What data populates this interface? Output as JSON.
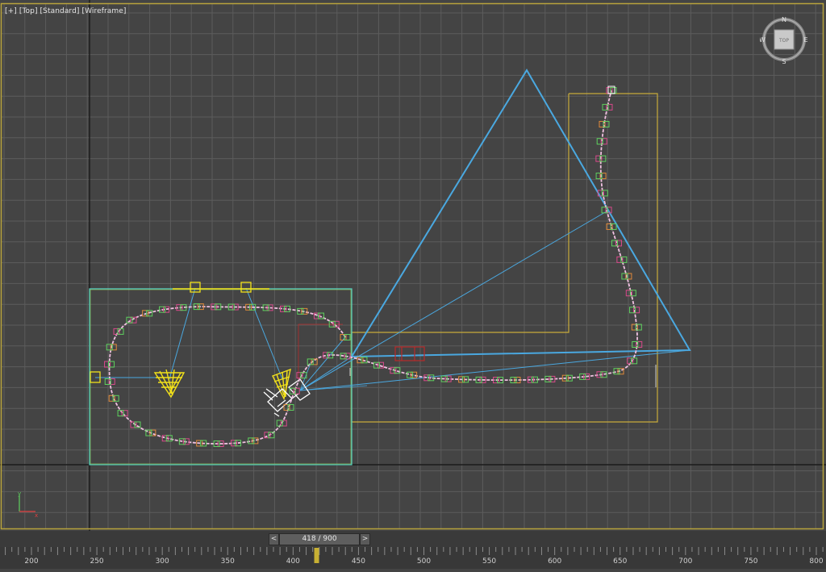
{
  "viewport": {
    "label_parts": [
      "[+]",
      "[Top]",
      "[Standard]",
      "[Wireframe]"
    ]
  },
  "viewcube": {
    "face": "TOP",
    "north": "N",
    "south": "S",
    "east": "E",
    "west": "W"
  },
  "axis_tripod": {
    "x": "x",
    "y": "y"
  },
  "time_slider": {
    "frame_text": "418 / 900",
    "prev": "<",
    "next": ">"
  },
  "trackbar": {
    "ticks": [
      "200",
      "250",
      "300",
      "350",
      "400",
      "450",
      "500",
      "550",
      "600",
      "650",
      "700",
      "750",
      "800"
    ],
    "current_frame": 418
  },
  "colors": {
    "viewport_bg": "#444444",
    "grid": "#5c5c5c",
    "active_border": "#b8a33c",
    "path": "#f0c0e0",
    "camera": "#4aa8e0",
    "yellow": "#f2e11a",
    "box_cyan": "#56d6c8",
    "selection_box": "#c8ab3a"
  }
}
